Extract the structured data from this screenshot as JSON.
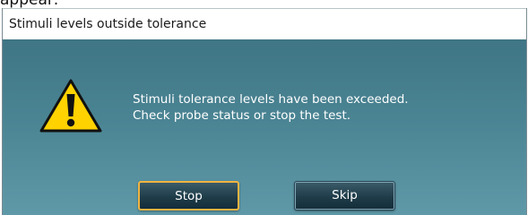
{
  "top_fragment": "appear:",
  "dialog": {
    "title": "Stimuli levels outside tolerance",
    "message_line1": "Stimuli tolerance levels have been exceeded.",
    "message_line2": "Check probe status or stop the test.",
    "icon": "warning-icon",
    "buttons": {
      "stop_label": "Stop",
      "skip_label": "Skip"
    },
    "colors": {
      "body_background": "#4a8493",
      "button_background": "#1f3c49",
      "focused_border": "#f0b441",
      "warning_fill": "#ffd200"
    }
  }
}
